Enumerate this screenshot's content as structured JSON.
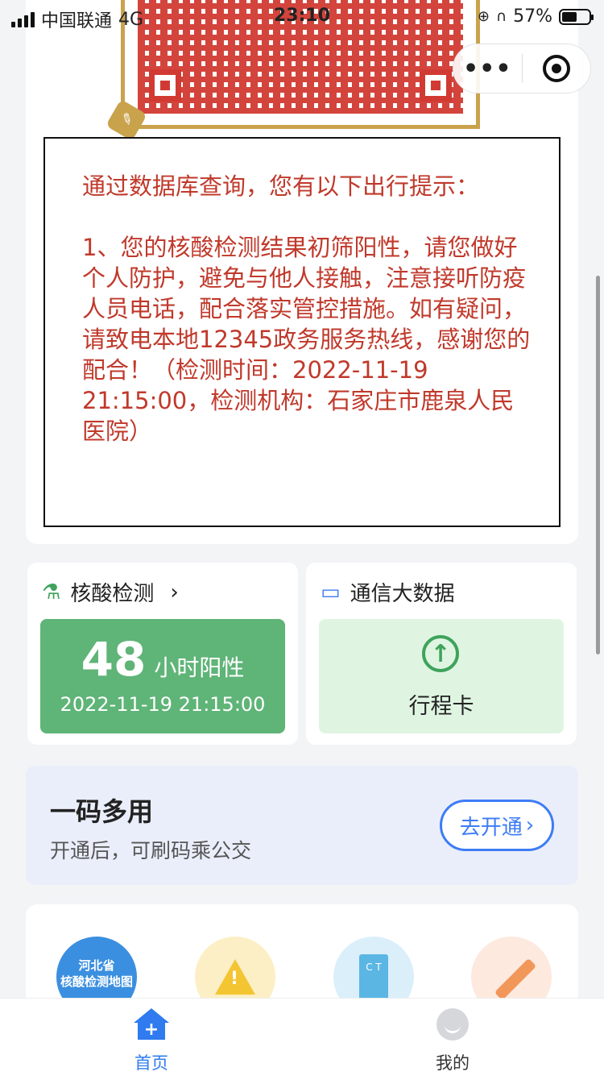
{
  "status_bar": {
    "carrier": "中国联通",
    "network": "4G",
    "time": "23:10",
    "battery_percent": "57%",
    "battery_level": 0.57
  },
  "notice": {
    "text": "通过数据库查询，您有以下出行提示：\n\n1、您的核酸检测结果初筛阳性，请您做好个人防护，避免与他人接触，注意接听防疫人员电话，配合落实管控措施。如有疑问，请致电本地12345政务服务热线，感谢您的配合！（检测时间：2022-11-19 21:15:00，检测机构：石家庄市鹿泉人民医院）",
    "color": "#c0392b"
  },
  "nucleic_card": {
    "title": "核酸检测",
    "chevron": "›",
    "hours": "48",
    "result_label": "小时阳性",
    "timestamp": "2022-11-19 21:15:00",
    "color": "#5fb477"
  },
  "bigdata_card": {
    "title": "通信大数据",
    "action_label": "行程卡",
    "icon": "up-arrow-circle-icon"
  },
  "promo": {
    "title": "一码多用",
    "subtitle": "开通后，可刷码乘公交",
    "button_label": "去开通",
    "button_arrow": "›"
  },
  "services": {
    "map_label_line1": "河北省",
    "map_label_line2": "核酸检测地图",
    "ct_label": "C T"
  },
  "tab_bar": {
    "home_label": "首页",
    "mine_label": "我的",
    "active_color": "#2f7bef"
  }
}
